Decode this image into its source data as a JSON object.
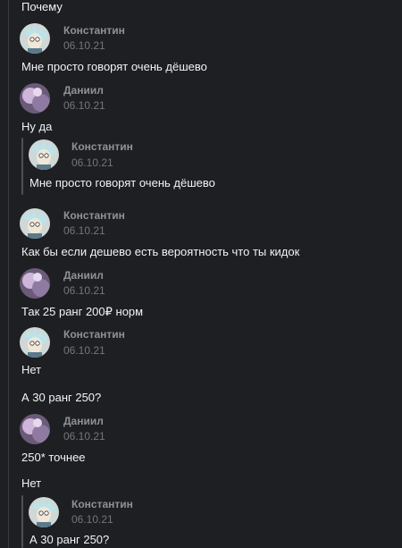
{
  "messages": {
    "m0": "Почему",
    "m1": "Мне просто говорят очень дёшево",
    "m2": "Ну да",
    "m3": "Как бы если дешево есть вероятность что ты кидок",
    "m4": "Так 25 ранг 200₽ норм",
    "m5": "Нет",
    "m6": "А 30 ранг 250?",
    "m7": "250* точнее",
    "m8": "Нет"
  },
  "posts": {
    "p1": {
      "author": "Константин",
      "date": "06.10.21",
      "avatar_icon": "rick-avatar-icon"
    },
    "p2": {
      "author": "Даниил",
      "date": "06.10.21",
      "avatar_icon": "purple-avatar-icon"
    },
    "p3": {
      "author": "Константин",
      "date": "06.10.21",
      "avatar_icon": "rick-avatar-icon"
    },
    "p4": {
      "author": "Даниил",
      "date": "06.10.21",
      "avatar_icon": "purple-avatar-icon"
    },
    "p5": {
      "author": "Константин",
      "date": "06.10.21",
      "avatar_icon": "rick-avatar-icon"
    },
    "p6": {
      "author": "Даниил",
      "date": "06.10.21",
      "avatar_icon": "purple-avatar-icon"
    }
  },
  "quotes": {
    "q1": {
      "author": "Константин",
      "date": "06.10.21",
      "text": "Мне просто говорят очень дёшево"
    },
    "q2": {
      "author": "Константин",
      "date": "06.10.21",
      "text": "А 30 ранг 250?"
    }
  },
  "colors": {
    "background": "#1e1f22",
    "text": "#f2f3f5",
    "name": "#8e9297",
    "date": "#72767d"
  }
}
